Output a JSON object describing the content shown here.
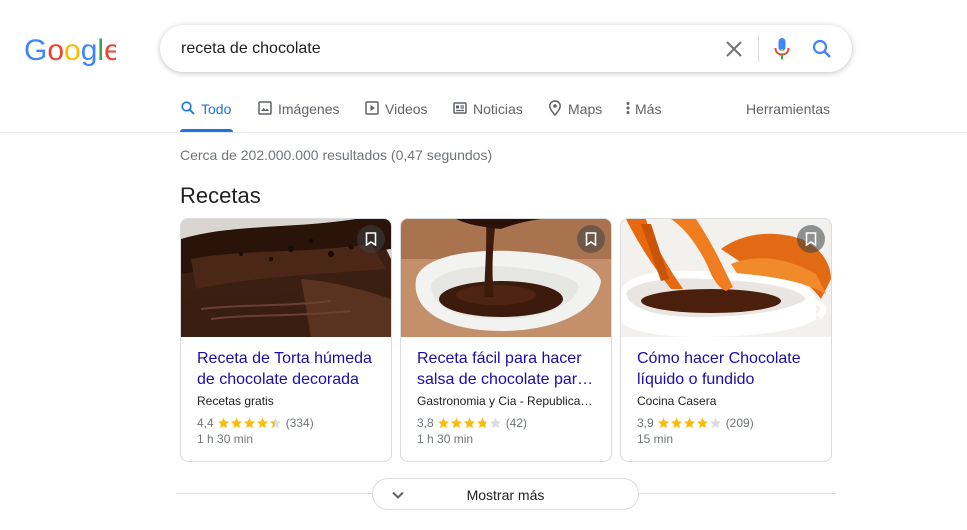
{
  "logo": {
    "letters": [
      "G",
      "o",
      "o",
      "g",
      "l",
      "e"
    ]
  },
  "search": {
    "query": "receta de chocolate"
  },
  "tabs": [
    {
      "label": "Todo",
      "icon": "search-icon"
    },
    {
      "label": "Imágenes",
      "icon": "image-icon"
    },
    {
      "label": "Videos",
      "icon": "play-icon"
    },
    {
      "label": "Noticias",
      "icon": "news-icon"
    },
    {
      "label": "Maps",
      "icon": "map-pin-icon"
    },
    {
      "label": "Más",
      "icon": "more-vert-icon"
    }
  ],
  "tools_label": "Herramientas",
  "stats": "Cerca de 202.000.000 resultados (0,47 segundos)",
  "section_title": "Recetas",
  "recipes": [
    {
      "title": "Receta de Torta húmeda de chocolate decorada",
      "source": "Recetas gratis",
      "rating": "4,4",
      "rating_value": 4.4,
      "reviews": "(334)",
      "time": "1 h 30 min"
    },
    {
      "title": "Receta fácil para hacer salsa de chocolate par…",
      "source": "Gastronomia y Cia - Republica…",
      "rating": "3,8",
      "rating_value": 3.8,
      "reviews": "(42)",
      "time": "1 h 30 min"
    },
    {
      "title": "Cómo hacer Chocolate líquido o fundido",
      "source": "Cocina Casera",
      "rating": "3,9",
      "rating_value": 3.9,
      "reviews": "(209)",
      "time": "15 min"
    }
  ],
  "show_more": "Mostrar más",
  "colors": {
    "link": "#1a0dab",
    "accent": "#1a73e8",
    "star": "#fbbc04"
  }
}
